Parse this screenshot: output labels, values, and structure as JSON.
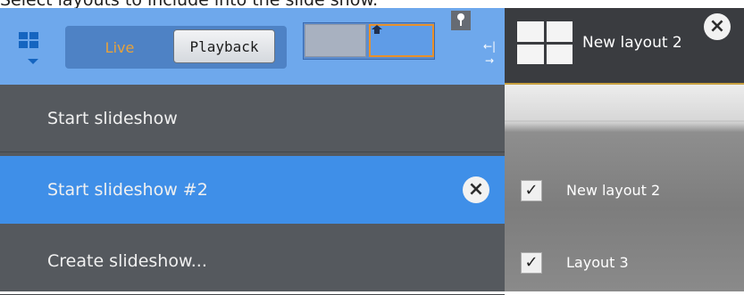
{
  "caption": "Select layouts to include into the slide show.",
  "toolbar": {
    "layouts_menu_icon": "layout-grid-icon",
    "live_label": "Live",
    "playback_label": "Playback",
    "pin_icon": "pin-icon",
    "resize_icon": "resize-icon"
  },
  "layout_tab": {
    "label": "New layout 2",
    "close_icon": "close-icon"
  },
  "menu": {
    "items": [
      {
        "label": "Start slideshow"
      },
      {
        "label": "Start slideshow #2",
        "selected": true,
        "close_icon": "close-icon"
      },
      {
        "label": "Create slideshow..."
      }
    ]
  },
  "layouts_list": [
    {
      "label": "New layout 2",
      "checked": true
    },
    {
      "label": "Layout 3",
      "checked": true
    }
  ],
  "colors": {
    "toolbar": "#6ea8ec",
    "selected_item": "#3f8fe8",
    "menu_bg": "#55595e",
    "accent_orange": "#e8902a"
  }
}
